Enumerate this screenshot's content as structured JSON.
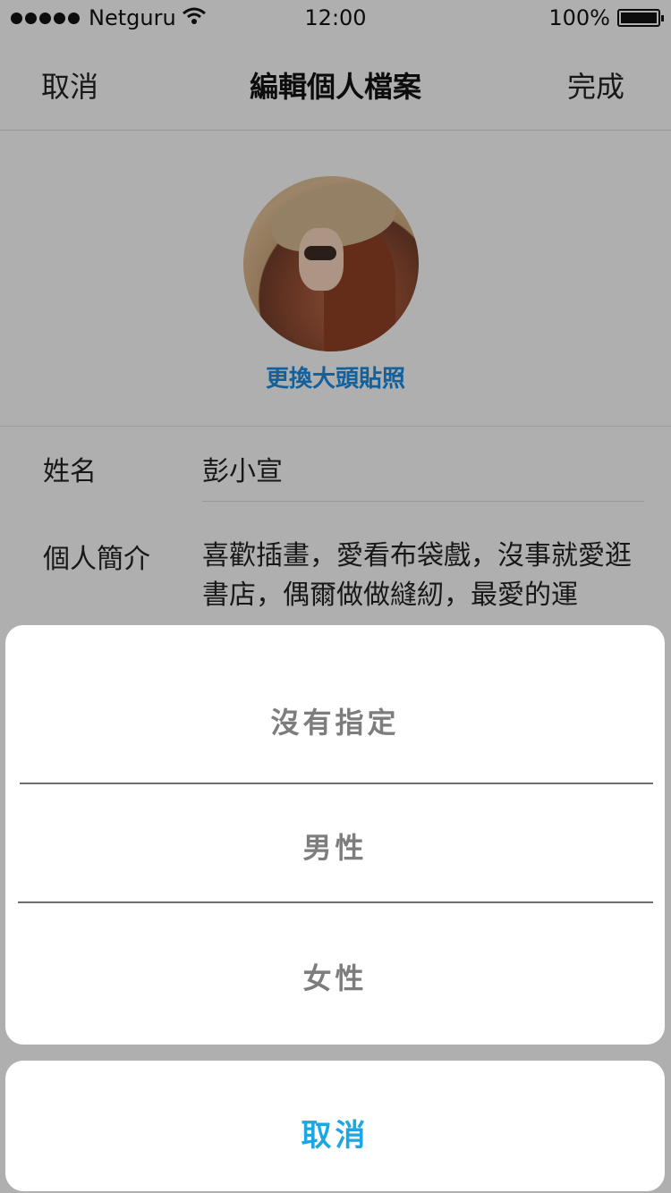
{
  "status_bar": {
    "carrier": "Netguru",
    "time": "12:00",
    "battery": "100%"
  },
  "nav": {
    "cancel": "取消",
    "title": "編輯個人檔案",
    "done": "完成"
  },
  "profile": {
    "change_photo": "更換大頭貼照",
    "name_label": "姓名",
    "name_value": "彭小宣",
    "bio_label": "個人簡介",
    "bio_value": "喜歡插畫，愛看布袋戲，沒事就愛逛書店，偶爾做做縫紉，最愛的運"
  },
  "action_sheet": {
    "options": [
      {
        "label": "沒有指定"
      },
      {
        "label": "男性"
      },
      {
        "label": "女性"
      }
    ],
    "cancel": "取消"
  },
  "colors": {
    "link_blue": "#1a86d8",
    "cancel_blue": "#1da6e4"
  }
}
